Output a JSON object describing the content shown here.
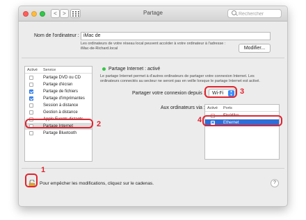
{
  "window": {
    "title": "Partage"
  },
  "toolbar": {
    "back_glyph": "<",
    "forward_glyph": ">",
    "search_placeholder": "Rechercher"
  },
  "computer": {
    "name_label": "Nom de l'ordinateur :",
    "name_value": "iMac de",
    "hint_line1": "Les ordinateurs de votre réseau local peuvent accéder à votre ordinateur à l'adresse :",
    "hint_line2": "iMac-de-Richard.local",
    "modify_button": "Modifier..."
  },
  "services": {
    "col_active": "Activé",
    "col_service": "Service",
    "items": [
      {
        "label": "Partage DVD ou CD",
        "checked": false
      },
      {
        "label": "Partage d'écran",
        "checked": false
      },
      {
        "label": "Partage de fichiers",
        "checked": true
      },
      {
        "label": "Partage d'imprimantes",
        "checked": true
      },
      {
        "label": "Session à distance",
        "checked": false
      },
      {
        "label": "Gestion à distance",
        "checked": false
      },
      {
        "label": "Apple Events distants",
        "checked": false
      },
      {
        "label": "Partage Internet",
        "checked": false,
        "selected": true
      },
      {
        "label": "Partage Bluetooth",
        "checked": false
      }
    ]
  },
  "detail": {
    "status": "Partage Internet : activé",
    "status_color": "#34c749",
    "desc_line1": "Le partage Internet permet à d'autres ordinateurs de partager votre connexion Internet. Les",
    "desc_line2": "ordinateurs connectés au secteur ne seront pas en veille lorsque le partage Internet est activé.",
    "share_from_label": "Partager votre connexion depuis :",
    "share_from_value": "Wi-Fi",
    "to_computers_label": "Aux ordinateurs via :",
    "ports_col_active": "Activé",
    "ports_col_ports": "Ports",
    "ports": [
      {
        "label": "FireWire",
        "checked": false
      },
      {
        "label": "Ethernet",
        "checked": true,
        "selected": true
      }
    ]
  },
  "footer": {
    "lock_text": "Pour empêcher les modifications, cliquez sur le cadenas.",
    "help": "?"
  },
  "annotations": {
    "n1": "1",
    "n2": "2",
    "n3": "3",
    "n4": "4",
    "color": "#e0232e"
  }
}
